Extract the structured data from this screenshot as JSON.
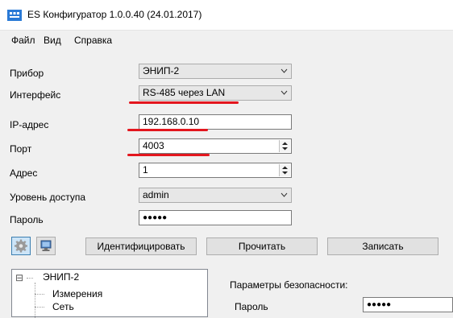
{
  "window": {
    "title": "ES Конфигуратор 1.0.0.40 (24.01.2017)"
  },
  "menu": [
    "Файл",
    "Вид",
    "Справка"
  ],
  "form": {
    "device": {
      "label": "Прибор",
      "value": "ЭНИП-2"
    },
    "interface": {
      "label": "Интерфейс",
      "value": "RS-485 через LAN"
    },
    "ip": {
      "label": "IP-адрес",
      "value": "192.168.0.10"
    },
    "port": {
      "label": "Порт",
      "value": "4003"
    },
    "address": {
      "label": "Адрес",
      "value": "1"
    },
    "access": {
      "label": "Уровень доступа",
      "value": "admin"
    },
    "password": {
      "label": "Пароль",
      "value": "●●●●●"
    }
  },
  "toolbar": {
    "identify": "Идентифицировать",
    "read": "Прочитать",
    "write": "Записать"
  },
  "tree": {
    "root": "ЭНИП-2",
    "expander": "⊟",
    "children": [
      "Измерения",
      "Сеть"
    ]
  },
  "security": {
    "title": "Параметры безопасности:",
    "password_label": "Пароль",
    "password_value": "●●●●●"
  },
  "colors": {
    "annotation": "#e3161e",
    "app_icon": "#2a7ad6"
  }
}
